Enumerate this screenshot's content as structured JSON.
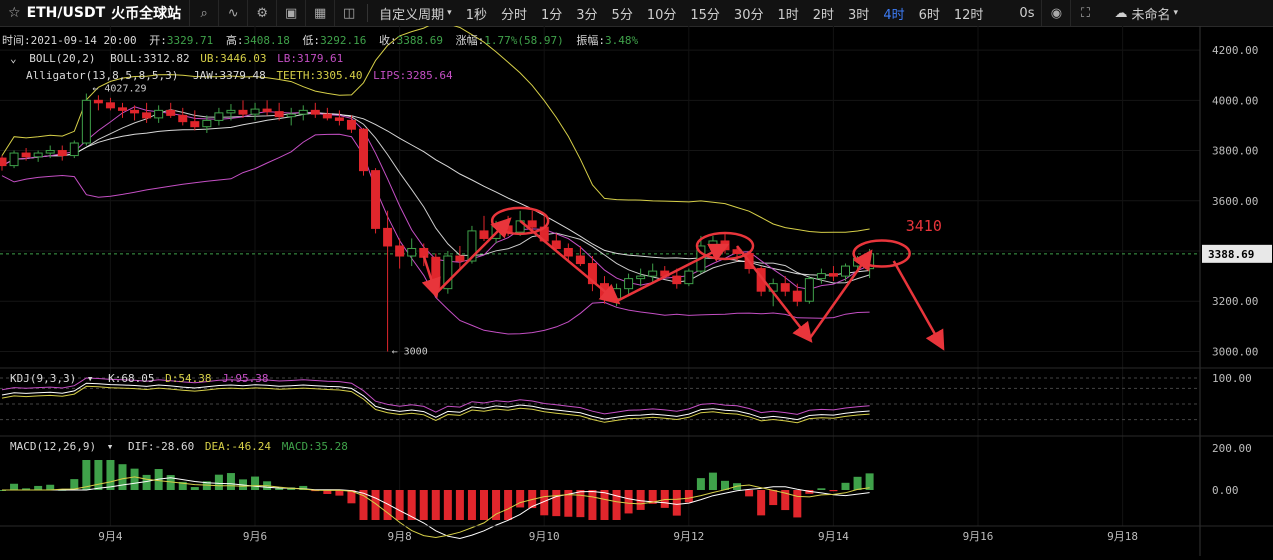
{
  "toolbar": {
    "symbol": "ETH/USDT",
    "exchange": "火币全球站",
    "custom_period": "自定义周期",
    "periods": [
      "1秒",
      "分时",
      "1分",
      "3分",
      "5分",
      "10分",
      "15分",
      "30分",
      "1时",
      "2时",
      "3时",
      "4时",
      "6时",
      "12时"
    ],
    "active_period": "4时",
    "countdown": "0s",
    "cloud_label": "未命名",
    "icons": [
      "star-icon",
      "search-icon",
      "indicator-icon",
      "settings-icon",
      "compare-icon",
      "image-icon",
      "layout-icon",
      "camera-icon",
      "fullscreen-icon",
      "cloud-icon",
      "chevron-down-icon"
    ]
  },
  "header": {
    "time_label": "时间:",
    "time": "2021-09-14 20:00",
    "open_label": "开:",
    "open": "3329.71",
    "high_label": "高:",
    "high": "3408.18",
    "low_label": "低:",
    "low": "3292.16",
    "close_label": "收:",
    "close": "3388.69",
    "change_label": "涨幅:",
    "change": "1.77%(58.97)",
    "amp_label": "振幅:",
    "amp": "3.48%"
  },
  "boll": {
    "name": "BOLL(20,2)",
    "boll": "BOLL:3312.82",
    "ub": "UB:3446.03",
    "lb": "LB:3179.61"
  },
  "alligator": {
    "name": "Alligator(13,8,5,8,5,3)",
    "jaw": "JAW:3379.48",
    "teeth": "TEETH:3305.40",
    "lips": "LIPS:3285.64"
  },
  "kdj": {
    "name": "KDJ(9,3,3)",
    "k": "K:68.05",
    "d": "D:54.38",
    "j": "J:95.38"
  },
  "macd": {
    "name": "MACD(12,26,9)",
    "dif": "DIF:-28.60",
    "dea": "DEA:-46.24",
    "macd": "MACD:35.28"
  },
  "price_axis": {
    "ticks": [
      "4200.00",
      "4000.00",
      "3800.00",
      "3600.00",
      "3400.00",
      "3200.00",
      "3000.00"
    ],
    "current": "3388.69"
  },
  "kdj_axis": {
    "ticks": [
      "100.00"
    ]
  },
  "macd_axis": {
    "ticks": [
      "200.00",
      "0.00"
    ]
  },
  "annotations": {
    "high_marker": "4027.29",
    "low_marker": "3000",
    "target": "3410"
  },
  "colors": {
    "up": "#3fa14a",
    "down": "#e0262c",
    "accent": "#3d7cf5",
    "boll": "#d8d8d8",
    "jaw": "#d6cf48",
    "lips": "#c44fc4",
    "annotation": "#e8353b"
  },
  "chart_data": {
    "type": "candlestick",
    "timeframe": "4H",
    "x_ticks": [
      "9月4",
      "9月6",
      "9月8",
      "9月10",
      "9月12",
      "9月14",
      "9月16",
      "9月18"
    ],
    "ylim": [
      2950,
      4280
    ],
    "candles": [
      [
        3770,
        3780,
        3720,
        3740
      ],
      [
        3740,
        3800,
        3730,
        3790
      ],
      [
        3790,
        3810,
        3760,
        3775
      ],
      [
        3775,
        3800,
        3755,
        3790
      ],
      [
        3790,
        3820,
        3770,
        3800
      ],
      [
        3800,
        3820,
        3760,
        3780
      ],
      [
        3780,
        3840,
        3770,
        3830
      ],
      [
        3830,
        4027,
        3820,
        4000
      ],
      [
        4000,
        4020,
        3960,
        3990
      ],
      [
        3990,
        4010,
        3960,
        3970
      ],
      [
        3970,
        3990,
        3930,
        3960
      ],
      [
        3960,
        3980,
        3920,
        3950
      ],
      [
        3950,
        3990,
        3910,
        3930
      ],
      [
        3930,
        3980,
        3910,
        3960
      ],
      [
        3960,
        3990,
        3930,
        3940
      ],
      [
        3940,
        3970,
        3900,
        3915
      ],
      [
        3915,
        3960,
        3880,
        3895
      ],
      [
        3895,
        3940,
        3870,
        3920
      ],
      [
        3920,
        3970,
        3900,
        3950
      ],
      [
        3950,
        3985,
        3920,
        3960
      ],
      [
        3960,
        4000,
        3930,
        3945
      ],
      [
        3945,
        3990,
        3920,
        3965
      ],
      [
        3965,
        4000,
        3940,
        3955
      ],
      [
        3955,
        3990,
        3920,
        3935
      ],
      [
        3935,
        3970,
        3900,
        3945
      ],
      [
        3945,
        3980,
        3920,
        3960
      ],
      [
        3960,
        3990,
        3930,
        3945
      ],
      [
        3945,
        3970,
        3920,
        3930
      ],
      [
        3930,
        3960,
        3900,
        3920
      ],
      [
        3920,
        3940,
        3870,
        3885
      ],
      [
        3885,
        3890,
        3700,
        3720
      ],
      [
        3720,
        3730,
        3470,
        3490
      ],
      [
        3490,
        3560,
        3000,
        3420
      ],
      [
        3420,
        3450,
        3330,
        3380
      ],
      [
        3380,
        3450,
        3340,
        3410
      ],
      [
        3410,
        3430,
        3340,
        3375
      ],
      [
        3375,
        3390,
        3230,
        3250
      ],
      [
        3250,
        3400,
        3230,
        3380
      ],
      [
        3380,
        3420,
        3330,
        3360
      ],
      [
        3360,
        3500,
        3350,
        3480
      ],
      [
        3480,
        3540,
        3440,
        3450
      ],
      [
        3450,
        3520,
        3430,
        3500
      ],
      [
        3500,
        3540,
        3460,
        3475
      ],
      [
        3475,
        3560,
        3460,
        3520
      ],
      [
        3520,
        3560,
        3470,
        3495
      ],
      [
        3495,
        3540,
        3460,
        3440
      ],
      [
        3440,
        3470,
        3400,
        3410
      ],
      [
        3410,
        3430,
        3360,
        3380
      ],
      [
        3380,
        3420,
        3340,
        3350
      ],
      [
        3350,
        3380,
        3240,
        3270
      ],
      [
        3270,
        3300,
        3190,
        3210
      ],
      [
        3210,
        3270,
        3180,
        3250
      ],
      [
        3250,
        3310,
        3220,
        3290
      ],
      [
        3290,
        3330,
        3260,
        3300
      ],
      [
        3300,
        3350,
        3270,
        3320
      ],
      [
        3320,
        3340,
        3290,
        3300
      ],
      [
        3300,
        3330,
        3250,
        3270
      ],
      [
        3270,
        3330,
        3260,
        3320
      ],
      [
        3320,
        3460,
        3310,
        3420
      ],
      [
        3420,
        3460,
        3390,
        3440
      ],
      [
        3440,
        3470,
        3390,
        3405
      ],
      [
        3405,
        3420,
        3360,
        3390
      ],
      [
        3390,
        3400,
        3310,
        3330
      ],
      [
        3330,
        3340,
        3220,
        3240
      ],
      [
        3240,
        3290,
        3180,
        3270
      ],
      [
        3270,
        3300,
        3220,
        3240
      ],
      [
        3240,
        3270,
        3180,
        3200
      ],
      [
        3200,
        3300,
        3190,
        3290
      ],
      [
        3290,
        3330,
        3270,
        3310
      ],
      [
        3310,
        3340,
        3280,
        3300
      ],
      [
        3300,
        3350,
        3280,
        3340
      ],
      [
        3340,
        3380,
        3320,
        3370
      ],
      [
        3329.71,
        3408.18,
        3292.16,
        3388.69
      ]
    ],
    "current_price": 3388.69
  }
}
